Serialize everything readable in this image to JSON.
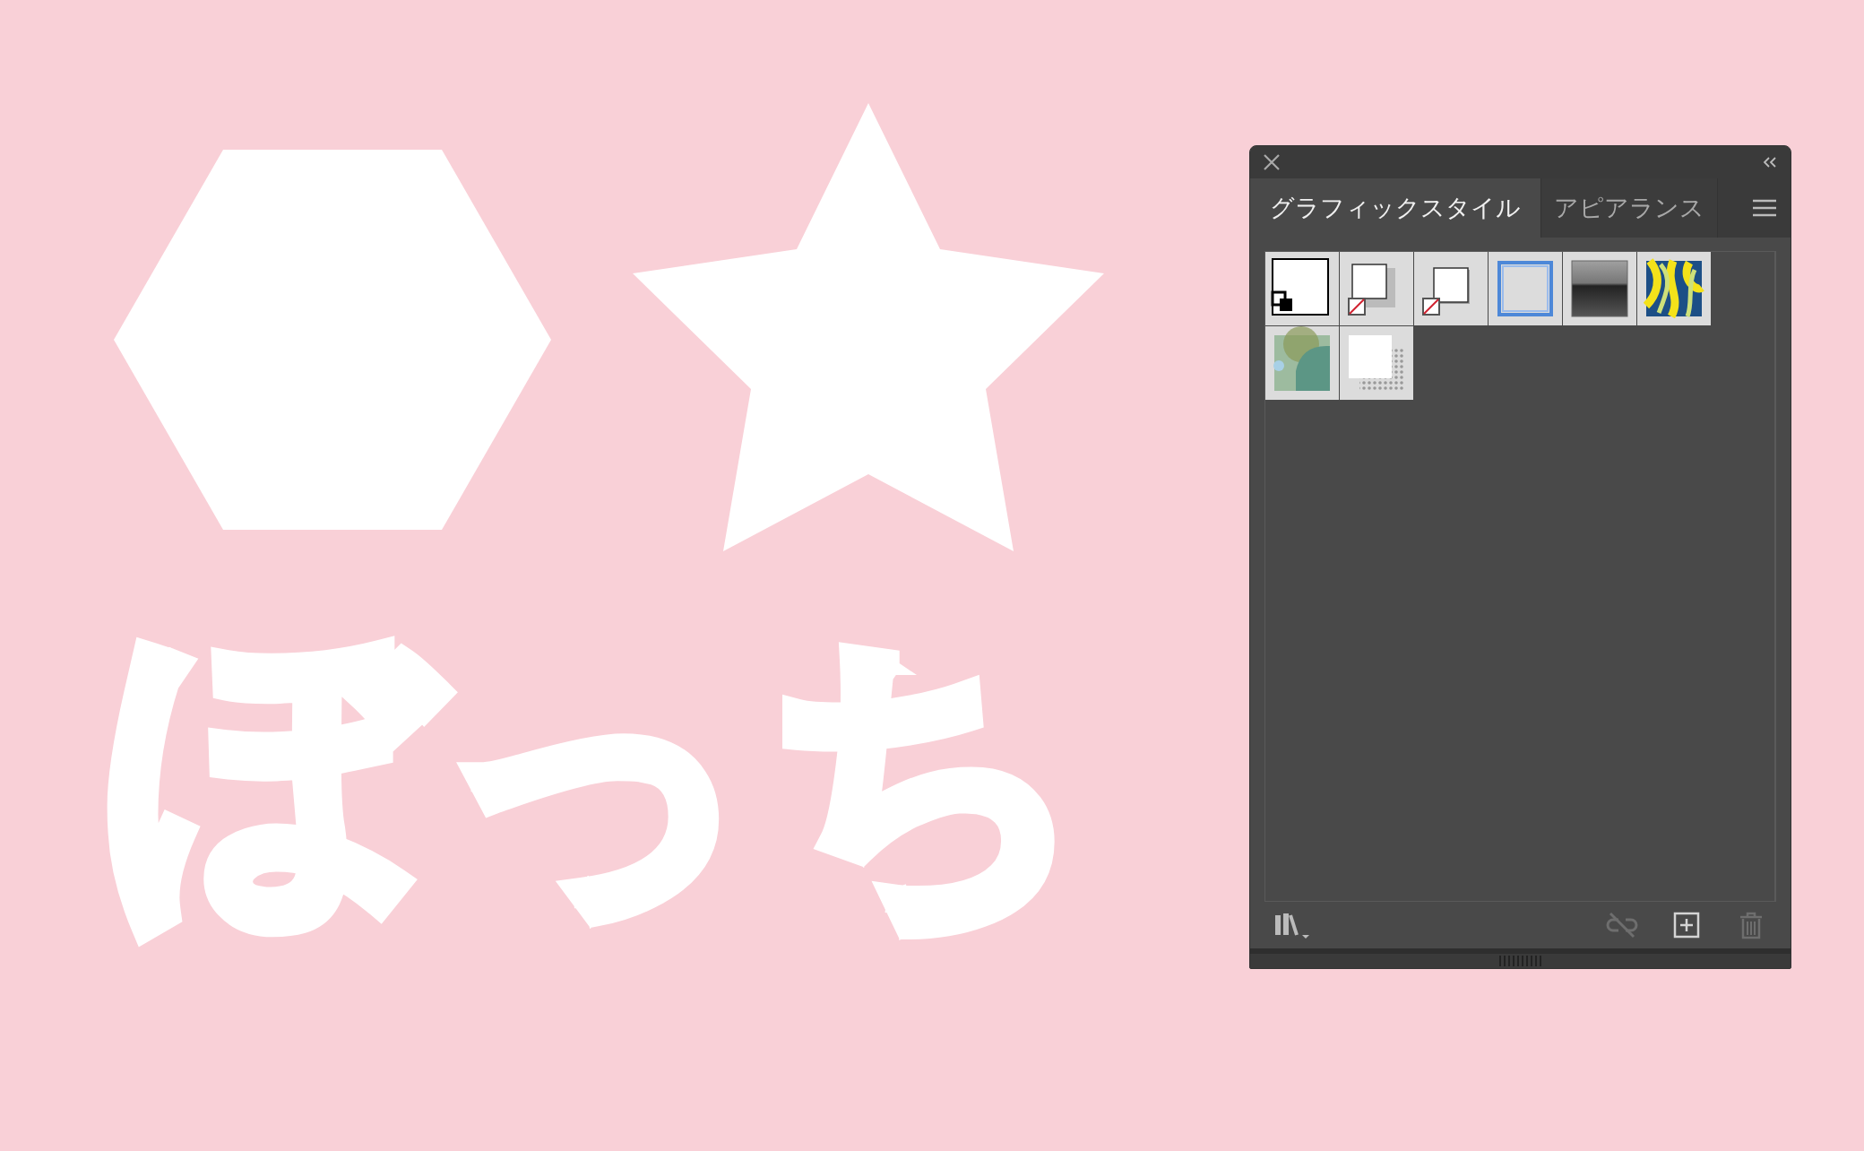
{
  "artboard": {
    "text": "ぼっち"
  },
  "panel": {
    "tabs": [
      {
        "label": "グラフィックスタイル",
        "selected": true
      },
      {
        "label": "アピアランス",
        "selected": false
      }
    ],
    "swatches": [
      {
        "kind": "default"
      },
      {
        "kind": "shadow"
      },
      {
        "kind": "shadow-small"
      },
      {
        "kind": "double-border"
      },
      {
        "kind": "gradient"
      },
      {
        "kind": "pattern"
      },
      {
        "kind": "landscape"
      },
      {
        "kind": "halftone"
      }
    ],
    "footer_buttons": [
      {
        "kind": "unlink",
        "disabled": true
      },
      {
        "kind": "new",
        "disabled": false
      },
      {
        "kind": "delete",
        "disabled": true
      }
    ]
  }
}
